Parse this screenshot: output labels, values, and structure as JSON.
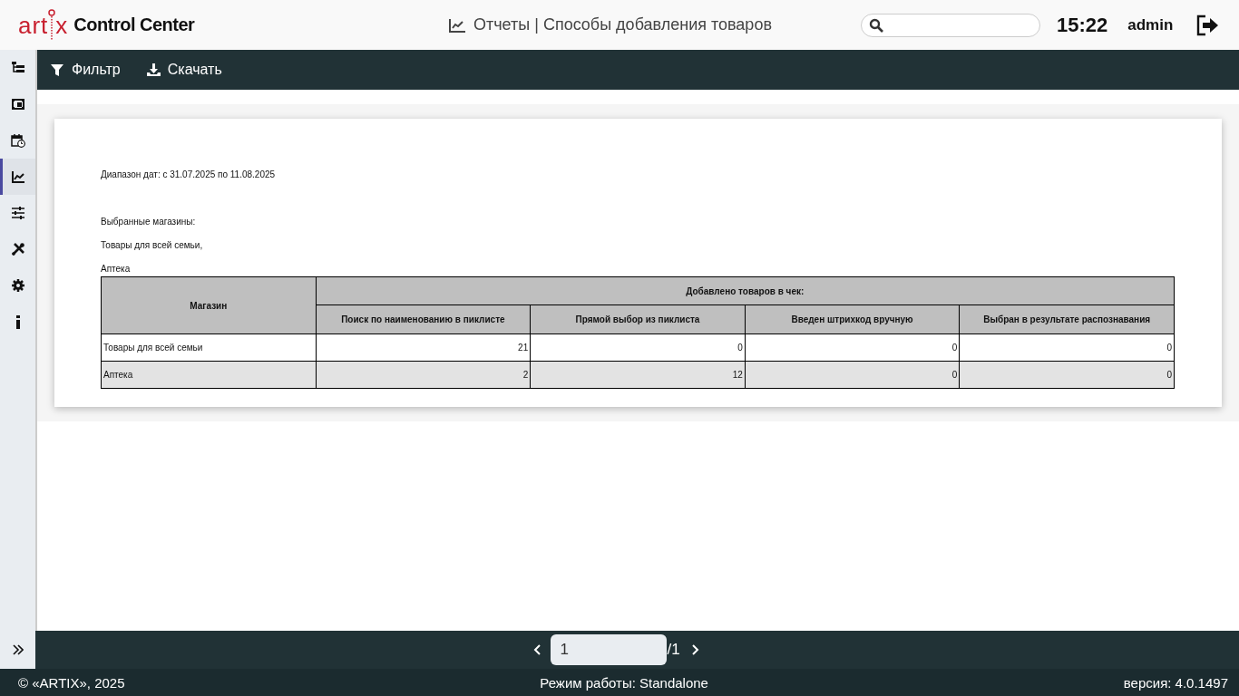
{
  "header": {
    "logo_left": "art",
    "logo_right": "x",
    "app_title": "Control Center",
    "page_title": "Отчеты | Способы добавления товаров",
    "time": "15:22",
    "user": "admin"
  },
  "sidebar": {
    "items": [
      {
        "selected": false
      },
      {
        "selected": false
      },
      {
        "selected": false
      },
      {
        "selected": true
      },
      {
        "selected": false
      },
      {
        "selected": false
      },
      {
        "selected": false
      },
      {
        "selected": false
      }
    ]
  },
  "toolbar": [
    {
      "label": "Фильтр"
    },
    {
      "label": "Скачать"
    }
  ],
  "report": {
    "lines": [
      "Диапазон дат: с 31.07.2025 по 11.08.2025",
      "Выбранные магазины:",
      "Товары для всей семьи,",
      "Аптека"
    ],
    "table": {
      "store_header": "Магазин",
      "group_header": "Добавлено товаров в чек:",
      "columns": [
        "Поиск по наименованию в пиклисте",
        "Прямой выбор из пиклиста",
        "Введен штрихкод вручную",
        "Выбран в результате распознавания"
      ],
      "rows": [
        {
          "store": "Товары для всей семьи",
          "values": [
            "21",
            "0",
            "0",
            "0"
          ]
        },
        {
          "store": "Аптека",
          "values": [
            "2",
            "12",
            "0",
            "0"
          ]
        }
      ]
    }
  },
  "pager": {
    "page": "1",
    "total": "/1"
  },
  "footer": {
    "copyright": "© «ARTIX», 2025",
    "mode": "Режим работы: Standalone",
    "version": "версия: 4.0.1497"
  }
}
